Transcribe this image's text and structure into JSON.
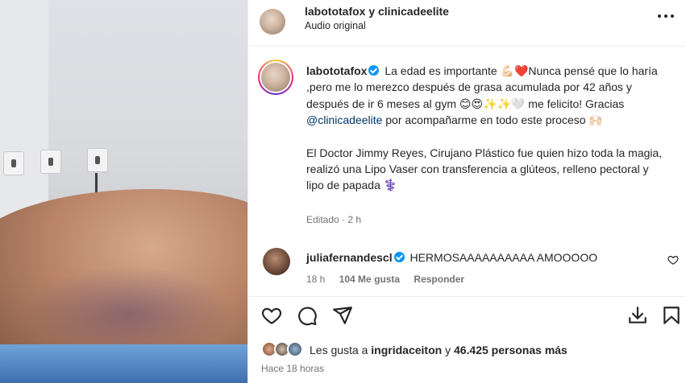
{
  "header": {
    "title": "labototafox y clinicadeelite",
    "audio": "Audio original"
  },
  "caption": {
    "username": "labototafox",
    "p1_a": "La edad es importante 💪🏻❤️Nunca pensé que lo haría ,pero me lo merezco después de grasa acumulada por 42 años y después de ir 6 meses al gym 😊😍✨✨🤍 me felicito! Gracias ",
    "mention": "@clinicadeelite",
    "p1_b": " por acompañarme en todo este proceso 🙌🏻",
    "p2": "El Doctor Jimmy Reyes, Cirujano Plástico fue quien hizo toda la magia, realizó una Lipo Vaser con transferencia a glúteos, relleno pectoral y lipo de papada ⚕️",
    "edited": "Editado · 2 h"
  },
  "comment": {
    "username": "juliafernandescl",
    "text": "HERMOSAAAAAAAAAA AMOOOOO",
    "time": "18 h",
    "likes": "104 Me gusta",
    "reply": "Responder"
  },
  "likes": {
    "prefix": "Les gusta a ",
    "user": "ingridaceiton",
    "middle": " y ",
    "count": "46.425 personas más"
  },
  "timestamp": "Hace 18 horas",
  "icons": [
    "more-icon",
    "verified-icon",
    "heart-icon",
    "comment-icon",
    "share-icon",
    "download-icon",
    "save-icon"
  ],
  "colors": {
    "link": "#00376b",
    "verified": "#0095f6",
    "muted": "#737373"
  }
}
